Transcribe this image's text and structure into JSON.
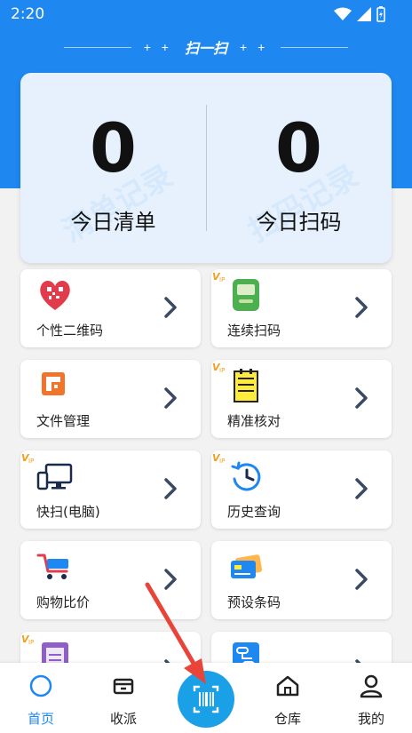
{
  "status_bar": {
    "time": "2:20"
  },
  "header": {
    "title": "扫一扫",
    "plus_left": "+ +",
    "plus_right": "+ +"
  },
  "summary": {
    "left": {
      "count": "0",
      "label": "今日清单",
      "watermark": "清单记录"
    },
    "right": {
      "count": "0",
      "label": "今日扫码",
      "watermark": "扫码记录"
    }
  },
  "tiles": [
    {
      "label": "个性二维码",
      "icon": "heart-qr-icon",
      "vip": false
    },
    {
      "label": "连续扫码",
      "icon": "green-scanner-icon",
      "vip": true
    },
    {
      "label": "文件管理",
      "icon": "folder-icon",
      "vip": false
    },
    {
      "label": "精准核对",
      "icon": "notepad-icon",
      "vip": true
    },
    {
      "label": "快扫(电脑)",
      "icon": "computer-icon",
      "vip": true
    },
    {
      "label": "历史查询",
      "icon": "history-clock-icon",
      "vip": true
    },
    {
      "label": "购物比价",
      "icon": "shopping-cart-icon",
      "vip": false
    },
    {
      "label": "预设条码",
      "icon": "card-icon",
      "vip": false
    },
    {
      "label": "",
      "icon": "clipboard-icon",
      "vip": true
    },
    {
      "label": "",
      "icon": "flow-icon",
      "vip": false
    }
  ],
  "vip_badge": "VIP",
  "bottom_nav": [
    {
      "label": "首页",
      "icon": "home-circle-icon",
      "active": true
    },
    {
      "label": "收派",
      "icon": "box-icon",
      "active": false
    },
    {
      "label": "",
      "icon": "barcode-scan-icon",
      "active": false
    },
    {
      "label": "仓库",
      "icon": "warehouse-icon",
      "active": false
    },
    {
      "label": "我的",
      "icon": "user-icon",
      "active": false
    }
  ],
  "colors": {
    "primary": "#1e88f0",
    "scan_button": "#1aa0e6",
    "card_bg": "#e6f1fd",
    "chevron": "#3b4a63",
    "arrow": "#e8443a"
  }
}
